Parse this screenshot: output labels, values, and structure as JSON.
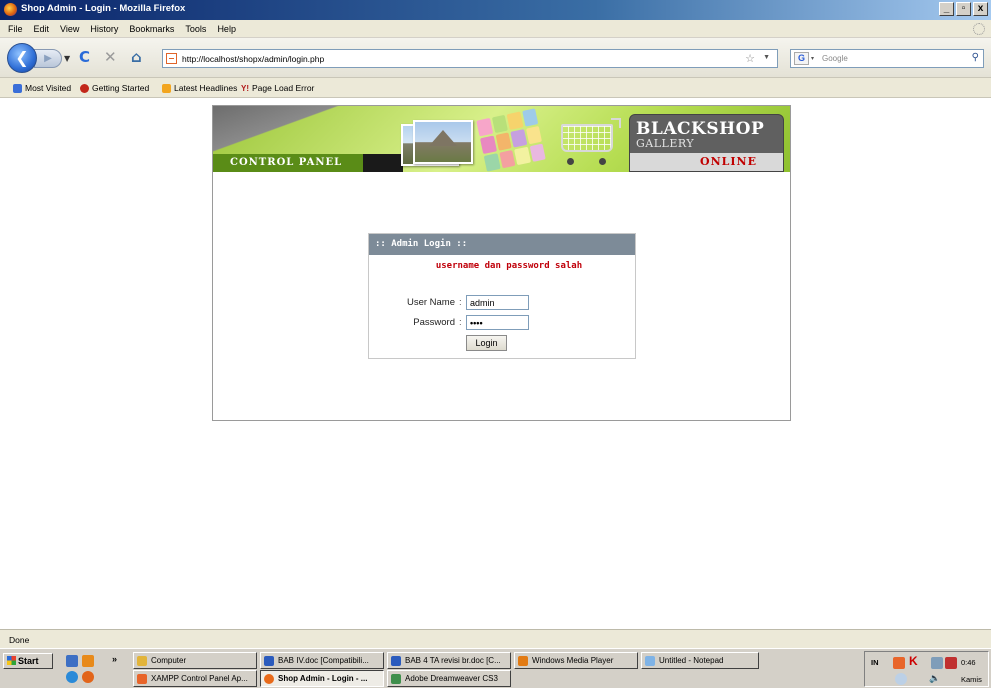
{
  "window": {
    "title": "Shop Admin - Login - Mozilla Firefox",
    "controls": [
      "_",
      " ̅",
      "x"
    ]
  },
  "menu": [
    "File",
    "Edit",
    "View",
    "History",
    "Bookmarks",
    "Tools",
    "Help"
  ],
  "nav": {
    "url": "http://localhost/shopx/admin/login.php",
    "search_placeholder": "Google",
    "search_engine": "G"
  },
  "bookmarks": [
    {
      "label": "Most Visited",
      "color": "#3a6ed8"
    },
    {
      "label": "Getting Started",
      "color": "#c2271a"
    },
    {
      "label": "Latest Headlines",
      "color": "#f2a51f"
    },
    {
      "label": "Page Load Error",
      "color": "#b01818",
      "icon_text": "Y!"
    }
  ],
  "banner": {
    "control_panel": "CONTROL PANEL",
    "logo_line1": "BLACKSHOP",
    "logo_line2": "GALLERY",
    "logo_line3": "ONLINE"
  },
  "login": {
    "header": ":: Admin Login ::",
    "error": "username dan password salah",
    "username_label": "User Name",
    "password_label": "Password",
    "colon": ":",
    "username_value": "admin",
    "password_value": "••••",
    "button": "Login"
  },
  "status": "Done",
  "taskbar": {
    "start": "Start",
    "row1": [
      {
        "label": "Computer",
        "color": "#e2b43a"
      },
      {
        "label": "BAB IV.doc [Compatibili...",
        "color": "#2b5bbd"
      },
      {
        "label": "BAB 4 TA revisi br.doc [C...",
        "color": "#2b5bbd"
      },
      {
        "label": "Windows Media Player",
        "color": "#e27b14"
      },
      {
        "label": "Untitled - Notepad",
        "color": "#7fb3e6"
      }
    ],
    "row2": [
      {
        "label": "XAMPP Control Panel Ap...",
        "color": "#e8652a"
      },
      {
        "label": "Shop Admin - Login - ...",
        "color": "#e86a1a"
      },
      {
        "label": "Adobe Dreamweaver CS3",
        "color": "#3f8f4c"
      }
    ],
    "tray": {
      "lang": "IN",
      "time": "0:46",
      "day": "Kamis"
    }
  },
  "colors": {
    "header_bar": "#7d8b98",
    "error_text": "#c0000a",
    "banner_green": "#9cc63a",
    "logo_online": "#c00000"
  }
}
